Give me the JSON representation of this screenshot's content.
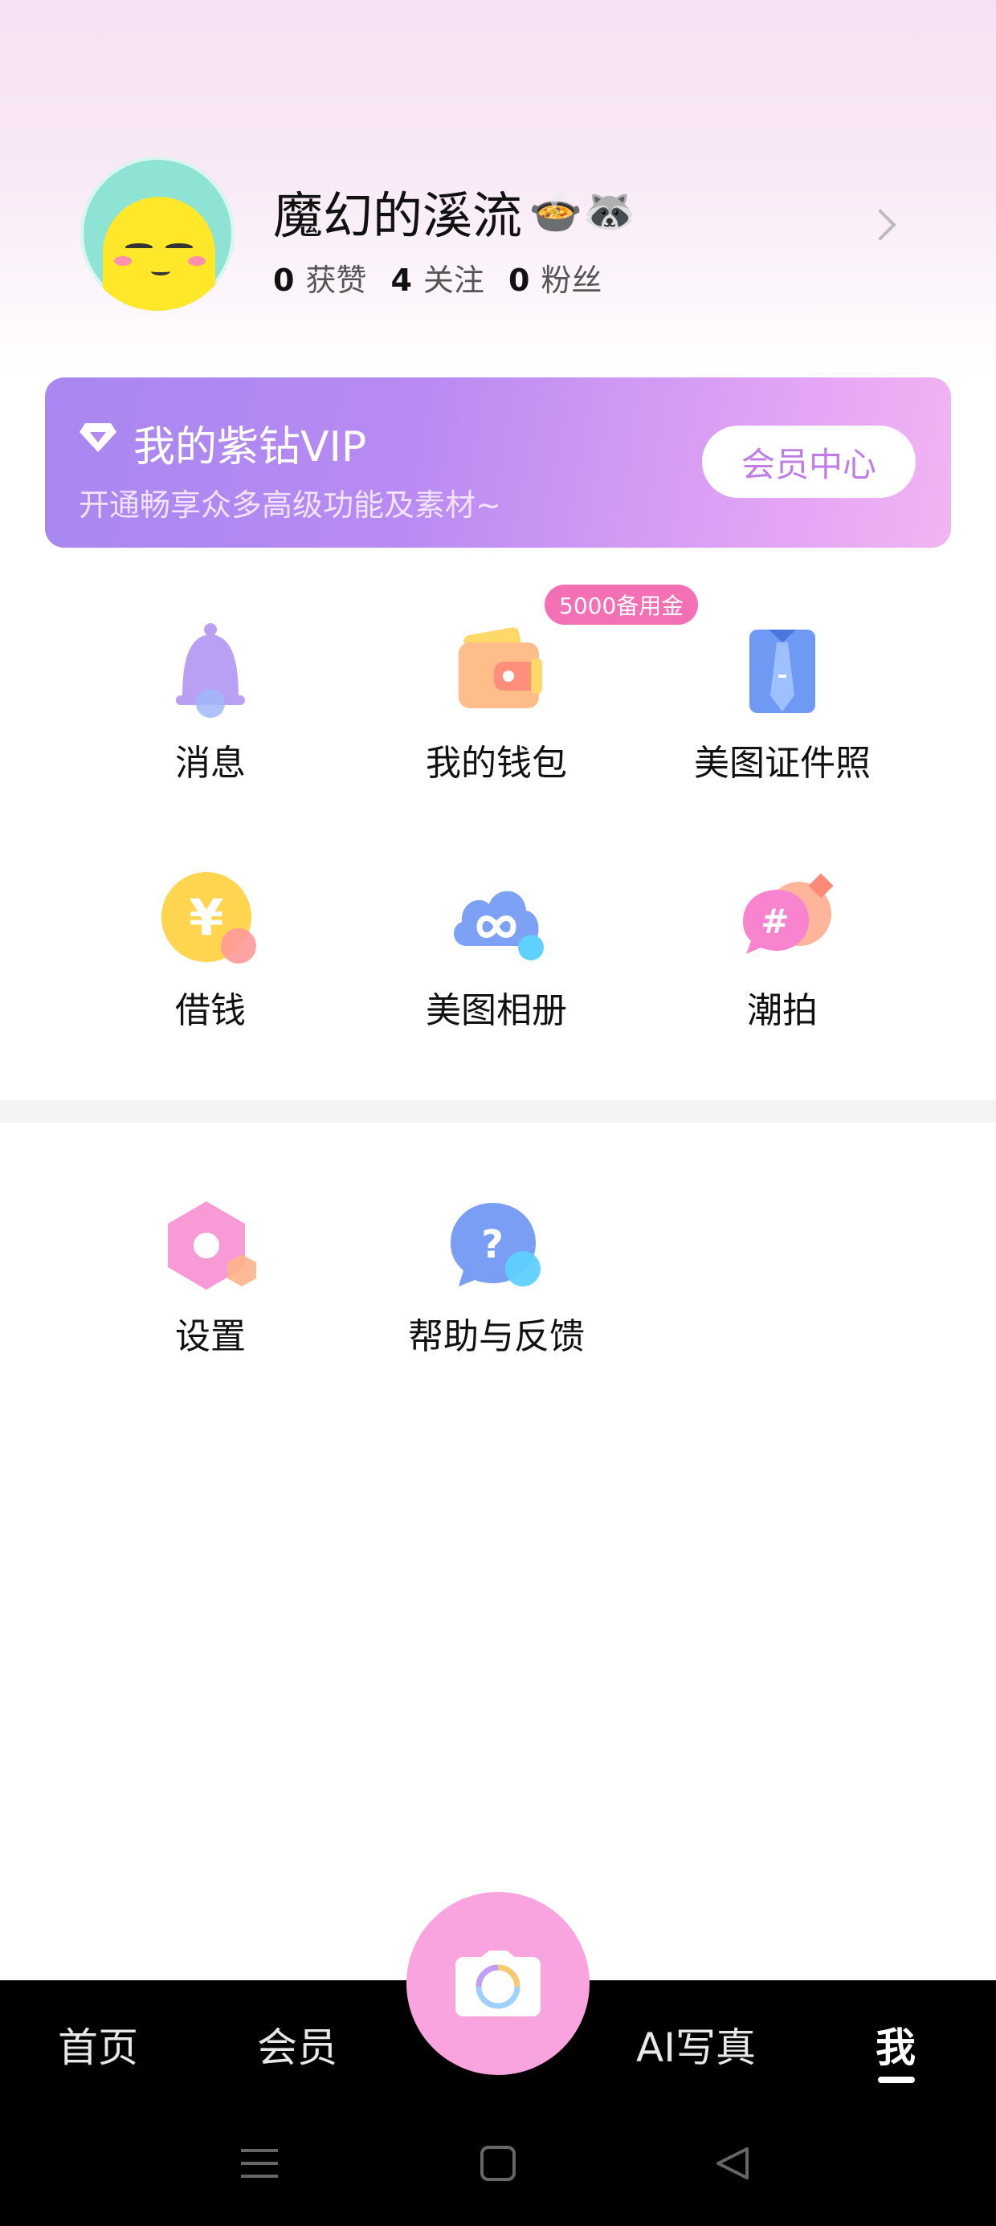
{
  "profile": {
    "username": "魔幻的溪流",
    "username_emojis": "🍲🦝",
    "stats": [
      {
        "num": "0",
        "label": "获赞"
      },
      {
        "num": "4",
        "label": "关注"
      },
      {
        "num": "0",
        "label": "粉丝"
      }
    ]
  },
  "vip": {
    "title": "我的紫钻VIP",
    "subtitle": "开通畅享众多高级功能及素材~",
    "button": "会员中心"
  },
  "grid": [
    {
      "label": "消息",
      "icon": "bell-icon"
    },
    {
      "label": "我的钱包",
      "icon": "wallet-icon",
      "badge": "5000备用金"
    },
    {
      "label": "美图证件照",
      "icon": "id-photo-icon"
    },
    {
      "label": "借钱",
      "icon": "yuan-coin-icon"
    },
    {
      "label": "美图相册",
      "icon": "cloud-album-icon"
    },
    {
      "label": "潮拍",
      "icon": "hashtag-chat-icon"
    }
  ],
  "tools": [
    {
      "label": "设置",
      "icon": "settings-hexagon-icon"
    },
    {
      "label": "帮助与反馈",
      "icon": "help-bubble-icon"
    }
  ],
  "bottom_nav": {
    "items": [
      "首页",
      "会员",
      "AI写真",
      "我"
    ],
    "active": "我"
  },
  "colors": {
    "accent_pink": "#f9a3df",
    "vip_purple": "#a787f0",
    "badge_pink": "#f470b4"
  }
}
